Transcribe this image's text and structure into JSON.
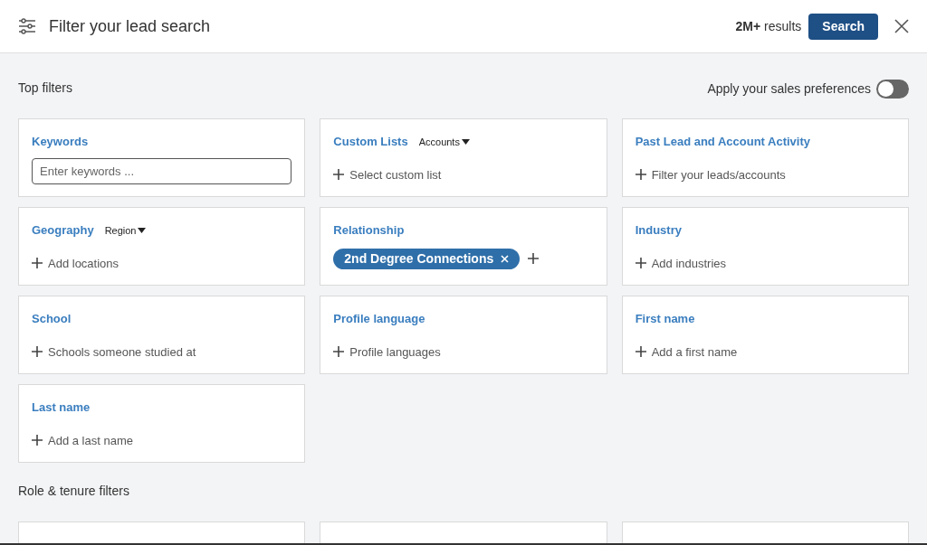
{
  "header": {
    "title": "Filter your lead search",
    "results_count": "2M+",
    "results_label": "results",
    "search_button": "Search"
  },
  "top_filters": {
    "heading": "Top filters",
    "preference_toggle": {
      "label": "Apply your sales preferences",
      "on": false
    },
    "cards": [
      {
        "kind": "input",
        "title": "Keywords",
        "placeholder": "Enter keywords ..."
      },
      {
        "kind": "add",
        "title": "Custom Lists",
        "dropdown": "Accounts",
        "action": "Select custom list"
      },
      {
        "kind": "add",
        "title": "Past Lead and Account Activity",
        "action": "Filter your leads/accounts"
      },
      {
        "kind": "add",
        "title": "Geography",
        "dropdown": "Region",
        "action": "Add locations"
      },
      {
        "kind": "chips",
        "title": "Relationship",
        "chips": [
          "2nd Degree Connections"
        ]
      },
      {
        "kind": "add",
        "title": "Industry",
        "action": "Add industries"
      },
      {
        "kind": "add",
        "title": "School",
        "action": "Schools someone studied at"
      },
      {
        "kind": "add",
        "title": "Profile language",
        "action": "Profile languages"
      },
      {
        "kind": "add",
        "title": "First name",
        "action": "Add a first name"
      },
      {
        "kind": "add",
        "title": "Last name",
        "action": "Add a last name"
      }
    ]
  },
  "role_filters": {
    "heading": "Role & tenure filters",
    "cards": [
      {
        "kind": "clipped"
      },
      {
        "kind": "clipped"
      },
      {
        "kind": "clipped"
      }
    ]
  }
}
